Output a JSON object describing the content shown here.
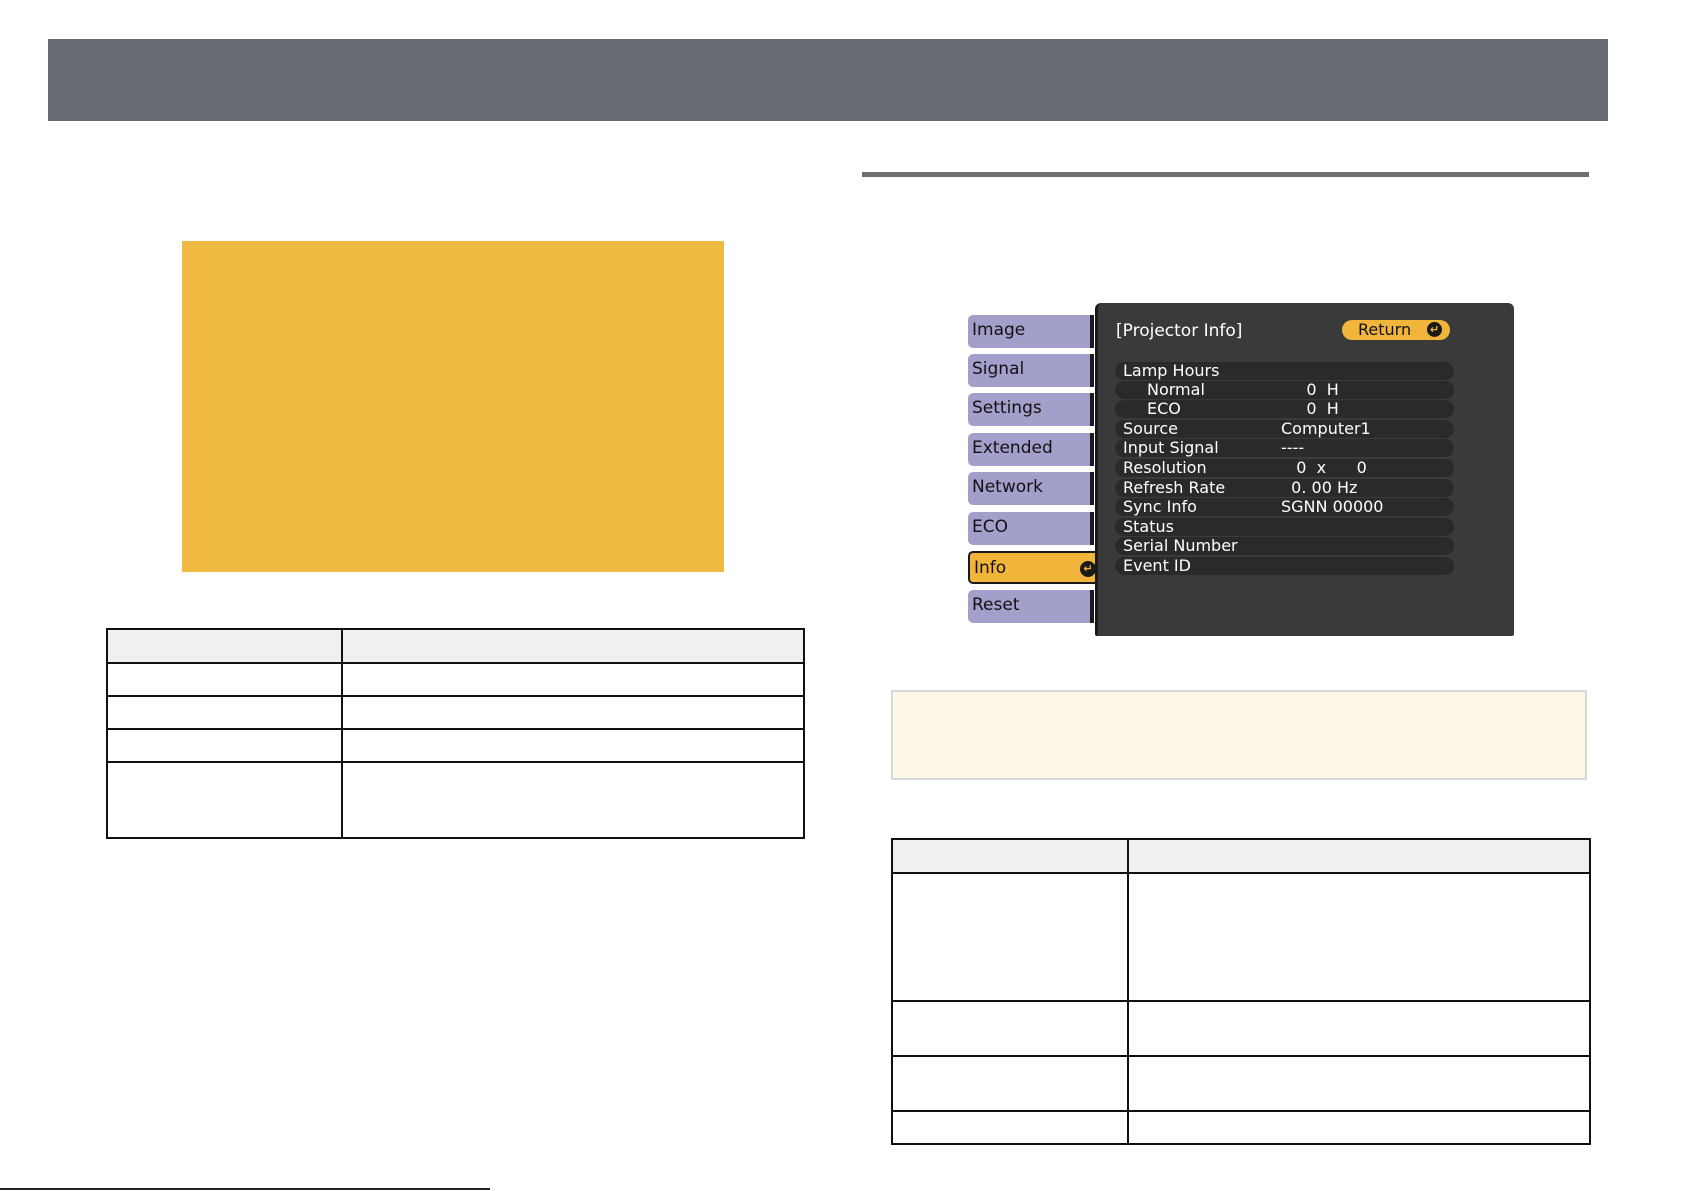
{
  "osd": {
    "title": "[Projector Info]",
    "return_label": "Return",
    "tabs": [
      {
        "label": "Image",
        "active": false
      },
      {
        "label": "Signal",
        "active": false
      },
      {
        "label": "Settings",
        "active": false
      },
      {
        "label": "Extended",
        "active": false
      },
      {
        "label": "Network",
        "active": false
      },
      {
        "label": "ECO",
        "active": false
      },
      {
        "label": "Info",
        "active": true
      },
      {
        "label": "Reset",
        "active": false
      }
    ],
    "rows": [
      {
        "label": "Lamp Hours",
        "value": ""
      },
      {
        "label": "Normal",
        "value": "     0  H"
      },
      {
        "label": "ECO",
        "value": "     0  H"
      },
      {
        "label": "Source",
        "value": "Computer1"
      },
      {
        "label": "Input Signal",
        "value": "----"
      },
      {
        "label": "Resolution",
        "value": "   0  x      0"
      },
      {
        "label": "Refresh Rate",
        "value": "  0. 00 Hz"
      },
      {
        "label": "Sync Info",
        "value": "SGNN 00000"
      },
      {
        "label": "Status",
        "value": ""
      },
      {
        "label": "Serial Number",
        "value": ""
      },
      {
        "label": "Event ID",
        "value": ""
      }
    ]
  },
  "colors": {
    "header_bar": "#666a73",
    "warning_block": "#f0b942",
    "tab_inactive": "#a39fcb",
    "tab_active": "#f2b53c",
    "osd_panel": "#3a3a3a",
    "note_box": "#fdf7e6"
  },
  "icons": {
    "enter": "enter-icon"
  }
}
